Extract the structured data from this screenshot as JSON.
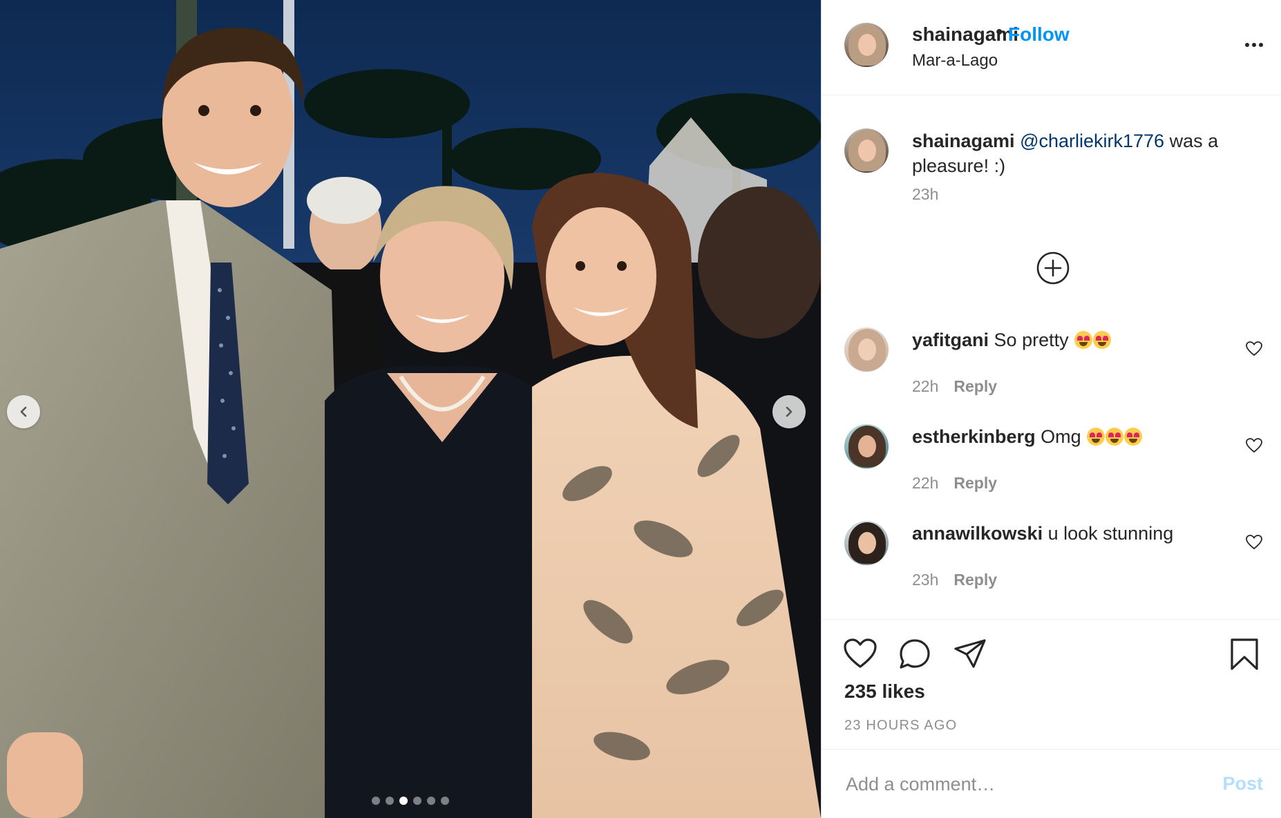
{
  "post": {
    "username": "shainagami",
    "follow_label": "Follow",
    "separator": "•",
    "location": "Mar-a-Lago",
    "caption_user": "shainagami",
    "caption_mention": "@charliekirk1776",
    "caption_text": " was a pleasure! :)",
    "caption_time": "23h",
    "likes": "235 likes",
    "posted_ago": "23 HOURS AGO"
  },
  "carousel": {
    "slide_count": 6,
    "active_slide": 3
  },
  "comments": [
    {
      "user": "yafitgani",
      "text": "So pretty",
      "emojis": 2,
      "time": "22h",
      "reply": "Reply"
    },
    {
      "user": "estherkinberg",
      "text": "Omg",
      "emojis": 3,
      "time": "22h",
      "reply": "Reply"
    },
    {
      "user": "annawilkowski",
      "text": "u look stunning",
      "emojis": 0,
      "time": "23h",
      "reply": "Reply"
    }
  ],
  "composer": {
    "placeholder": "Add a comment…",
    "post_label": "Post"
  },
  "icons": {
    "more": "more-options-icon",
    "like": "heart-icon",
    "comment": "comment-icon",
    "share": "paper-plane-icon",
    "save": "bookmark-icon",
    "load_more": "plus-circle-icon"
  },
  "colors": {
    "link_blue": "#0095f6",
    "post_disabled": "#b2dffc",
    "muted": "#8e8e8e",
    "text": "#262626"
  }
}
